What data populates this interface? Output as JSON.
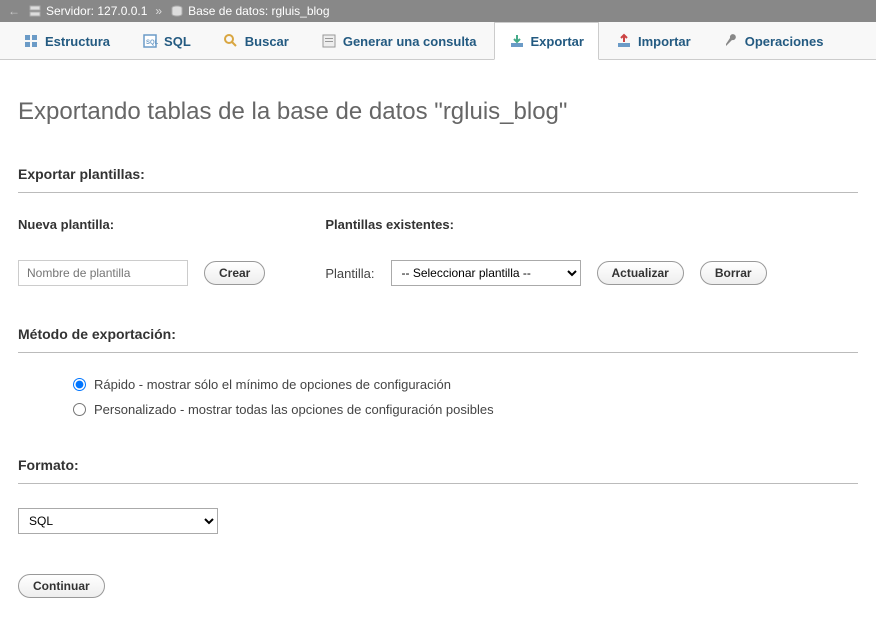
{
  "breadcrumb": {
    "server_label": "Servidor: 127.0.0.1",
    "database_label": "Base de datos: rgluis_blog"
  },
  "tabs": {
    "estructura": "Estructura",
    "sql": "SQL",
    "buscar": "Buscar",
    "generar": "Generar una consulta",
    "exportar": "Exportar",
    "importar": "Importar",
    "operaciones": "Operaciones"
  },
  "page_title": "Exportando tablas de la base de datos \"rgluis_blog\"",
  "export_templates": {
    "heading": "Exportar plantillas:",
    "new_template_label": "Nueva plantilla:",
    "new_template_placeholder": "Nombre de plantilla",
    "create_btn": "Crear",
    "existing_label": "Plantillas existentes:",
    "plantilla_label": "Plantilla:",
    "select_placeholder": "-- Seleccionar plantilla --",
    "update_btn": "Actualizar",
    "delete_btn": "Borrar"
  },
  "method": {
    "heading": "Método de exportación:",
    "quick": "Rápido - mostrar sólo el mínimo de opciones de configuración",
    "custom": "Personalizado - mostrar todas las opciones de configuración posibles"
  },
  "format": {
    "heading": "Formato:",
    "selected": "SQL"
  },
  "continue_btn": "Continuar"
}
